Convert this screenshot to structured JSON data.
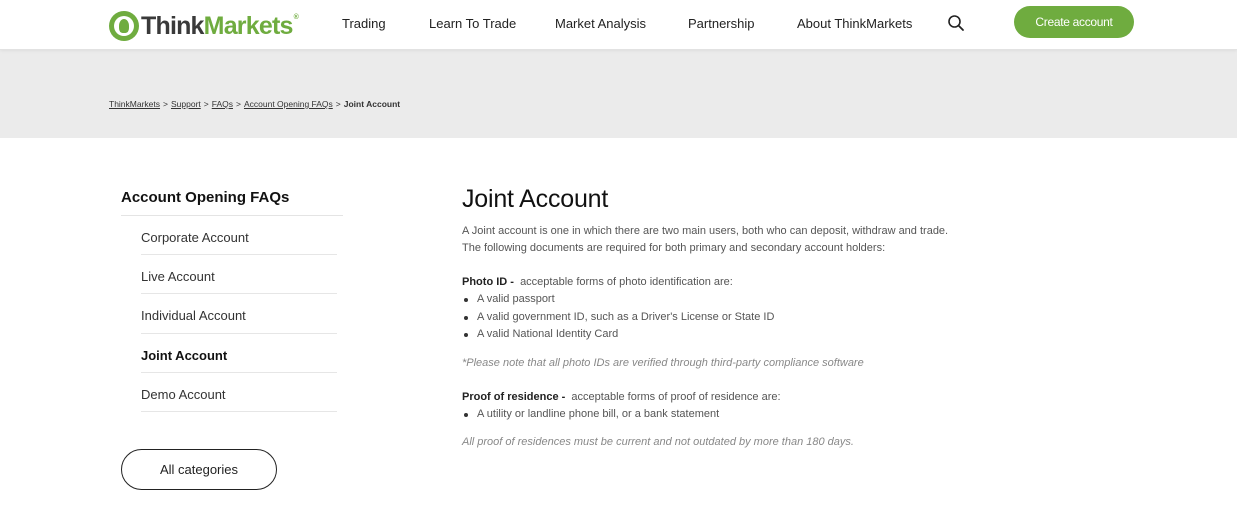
{
  "header": {
    "logo_think": "Think",
    "logo_markets": "Markets",
    "logo_reg": "®",
    "nav": [
      "Trading",
      "Learn To Trade",
      "Market Analysis",
      "Partnership",
      "About ThinkMarkets"
    ],
    "cta_label": "Create account",
    "brand_color": "#6fac3f"
  },
  "breadcrumb": {
    "items": [
      "ThinkMarkets",
      "Support",
      "FAQs",
      "Account Opening FAQs"
    ],
    "separator": ">",
    "current": "Joint Account"
  },
  "sidebar": {
    "title": "Account Opening FAQs",
    "items": [
      "Corporate Account",
      "Live Account",
      "Individual Account",
      "Joint Account",
      "Demo Account"
    ],
    "active_item": "Joint Account",
    "all_categories_label": "All categories"
  },
  "main": {
    "title": "Joint Account",
    "intro_line1": "A Joint account is one in which there are two main users, both who can deposit, withdraw and trade.",
    "intro_line2": "The following documents are required for both primary and secondary account holders:",
    "photo_id": {
      "label": "Photo ID -",
      "text": "acceptable forms of photo identification are:",
      "items": [
        "A valid passport",
        "A valid government ID, such as a Driver's License or State ID",
        "A valid National Identity Card"
      ],
      "note": "*Please note that all photo IDs are verified through third-party compliance software"
    },
    "proof_of_residence": {
      "label": "Proof of residence -",
      "text": "acceptable forms of proof of residence are:",
      "items": [
        "A utility or landline phone bill, or a bank statement"
      ],
      "note": "All proof of residences must be current and not outdated by more than 180 days."
    }
  }
}
